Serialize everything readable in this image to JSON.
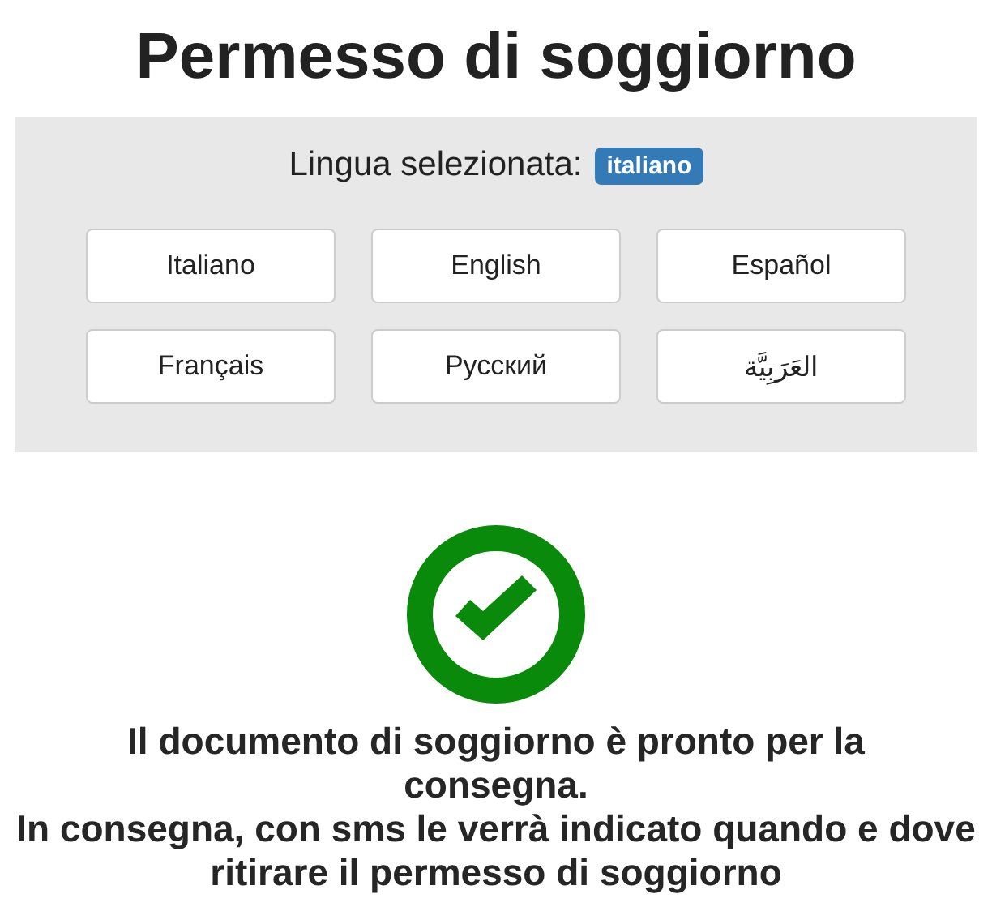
{
  "title": "Permesso di soggiorno",
  "language_panel": {
    "label": "Lingua selezionata:",
    "selected_language": "italiano",
    "buttons": [
      "Italiano",
      "English",
      "Español",
      "Français",
      "Русский",
      "العَرَبِيَّة"
    ]
  },
  "status": {
    "kind": "success",
    "messages": [
      "Il documento di soggiorno è pronto per la consegna.",
      "In consegna, con sms le verrà indicato quando e dove ritirare il permesso di soggiorno"
    ]
  }
}
